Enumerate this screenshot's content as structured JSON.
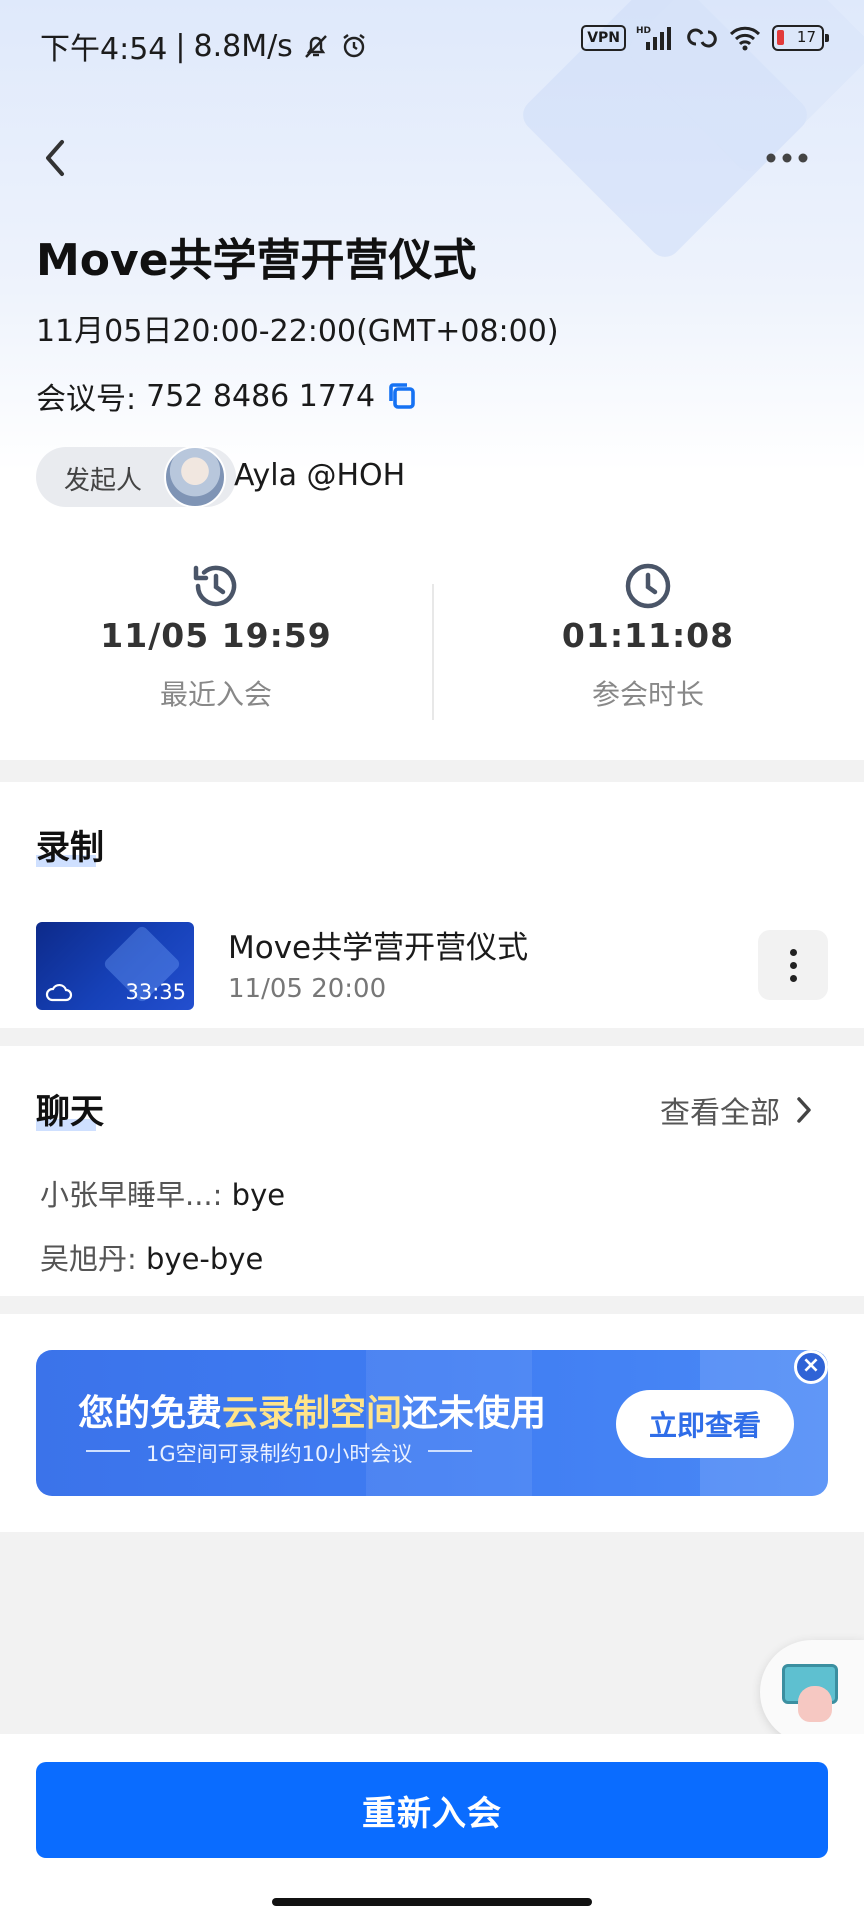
{
  "status_bar": {
    "time": "下午4:54",
    "separator": "|",
    "speed": "8.8M/s",
    "vpn": "VPN",
    "hd": "HD",
    "battery": "17"
  },
  "meeting": {
    "title": "Move共学营开营仪式",
    "datetime": "11月05日20:00-22:00(GMT+08:00)",
    "id_label": "会议号:",
    "id_value": "752 8486 1774",
    "host_label": "发起人",
    "host_name": "Ayla @HOH"
  },
  "stats": {
    "last_join_value": "11/05 19:59",
    "last_join_label": "最近入会",
    "duration_value": "01:11:08",
    "duration_label": "参会时长"
  },
  "recording": {
    "section_title": "录制",
    "item_title": "Move共学营开营仪式",
    "item_date": "11/05 20:00",
    "thumb_duration": "33:35"
  },
  "chat": {
    "section_title": "聊天",
    "view_all": "查看全部",
    "messages": [
      {
        "sender": "小张早睡早...:",
        "text": "bye"
      },
      {
        "sender": "吴旭丹:",
        "text": "bye-bye"
      }
    ]
  },
  "banner": {
    "title_part1": "您的免费",
    "title_highlight": "云录制空间",
    "title_part2": "还未使用",
    "subtitle": "1G空间可录制约10小时会议",
    "button": "立即查看",
    "close": "×"
  },
  "actions": {
    "rejoin": "重新入会"
  },
  "colors": {
    "primary": "#0a6cff",
    "banner": "#3f7cf2",
    "highlight": "#ffe48a"
  }
}
